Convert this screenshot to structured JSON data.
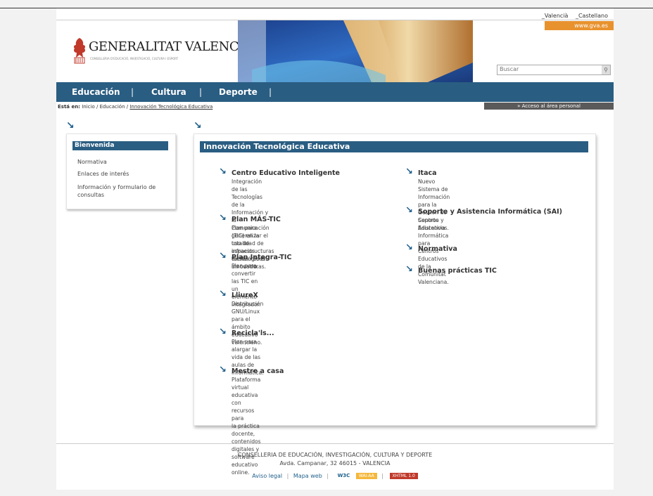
{
  "lang": [
    "_Valencià",
    "_Castellano"
  ],
  "gva": "www.gva.es",
  "logo": {
    "title": "GENERALITAT VALENCIANA",
    "subtitle": "CONSELLERIA D'EDUCACIÓ, INVESTIGACIÓ, CULTURA I ESPORT"
  },
  "search": {
    "placeholder": "Buscar"
  },
  "nav": {
    "educacion": "Educación",
    "cultura": "Cultura",
    "deporte": "Deporte",
    "sep": "|"
  },
  "breadcrumb": {
    "prefix": "Está en:",
    "path": "Inicio / Educación /",
    "current": "Innovación Tecnológica Educativa"
  },
  "access": "» Acceso al área personal",
  "sidebar": {
    "title": "Bienvenida",
    "items": [
      "Normativa",
      "Enlaces de interés",
      "Información y formulario de",
      "consultas"
    ]
  },
  "main": {
    "title": "Innovación Tecnológica Educativa",
    "left": [
      {
        "title": "Centro Educativo Inteligente",
        "lines": [
          "Integración de las Tecnologías de la",
          "Información y la Comunicación (TIC) en la",
          "totalidad de espacios existentes en un centro."
        ]
      },
      {
        "title": "Plan MÁS-TIC",
        "lines": [
          "Plan para generalizar el uso de",
          "infraestructuras tecnológicas innovadoras."
        ]
      },
      {
        "title": "Plan Integra-TIC",
        "lines": [
          "Plan para convertir las TIC en un elemento",
          "integrador."
        ]
      },
      {
        "title": "LliureX",
        "lines": [
          "Distribución GNU/Linux para el ámbito",
          "educativo valenciano."
        ]
      },
      {
        "title": "Recicla'ls...",
        "lines": [
          "Plan para alargar la vida de las aulas de",
          "informática."
        ]
      },
      {
        "title": "Mestre a casa",
        "lines": [
          "Plataforma virtual educativa con recursos para",
          "la práctica docente, contenidos digitales y",
          "software educativo online."
        ]
      }
    ],
    "right": [
      {
        "title": "Itaca",
        "lines": [
          "Nuevo Sistema de Información para la Gestión de",
          "Centros Educativos."
        ]
      },
      {
        "title": "Soporte y Asistencia Informática (SAI)",
        "lines": [
          "Soporte y Asistencia Informática para Centros",
          "Educativos de la Comunitat Valenciana."
        ]
      },
      {
        "title": "Normativa",
        "lines": []
      },
      {
        "title": "Buenas prácticas TIC",
        "lines": []
      }
    ]
  },
  "footer": {
    "line1": "CONSELLERIA DE EDUCACIÓN, INVESTIGACIÓN, CULTURA Y DEPORTE",
    "line2": "Avda. Campanar, 32 46015 - VALENCIA",
    "aviso": "Aviso legal",
    "mapa": "Mapa web",
    "w3c": "W3C",
    "wai": "WAI-AA",
    "xhtml": "XHTML 1.0"
  },
  "colors": {
    "nav_bg": "#2a5d82",
    "accent_orange": "#e8922e",
    "arrow": "#1f5f8b"
  },
  "icons": {
    "arrow": "diagonal-arrow-icon",
    "search": "search-icon",
    "logo": "gva-bat-logo-icon"
  }
}
